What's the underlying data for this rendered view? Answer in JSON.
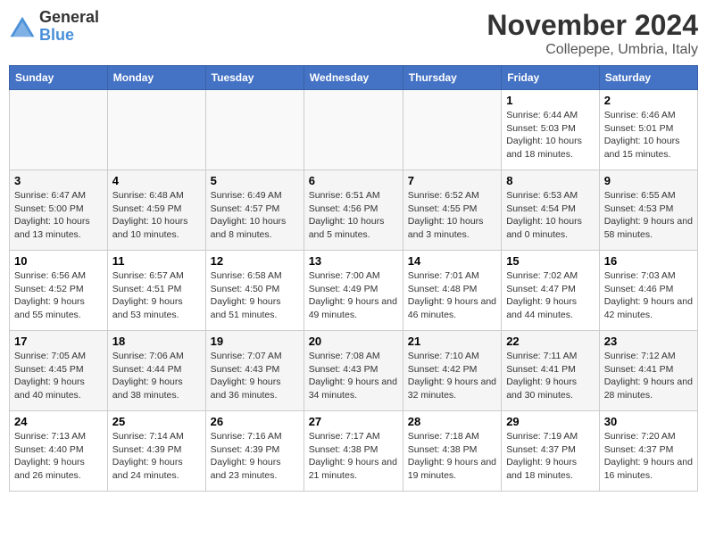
{
  "header": {
    "logo_general": "General",
    "logo_blue": "Blue",
    "month_title": "November 2024",
    "location": "Collepepe, Umbria, Italy"
  },
  "weekdays": [
    "Sunday",
    "Monday",
    "Tuesday",
    "Wednesday",
    "Thursday",
    "Friday",
    "Saturday"
  ],
  "weeks": [
    [
      {
        "day": "",
        "info": ""
      },
      {
        "day": "",
        "info": ""
      },
      {
        "day": "",
        "info": ""
      },
      {
        "day": "",
        "info": ""
      },
      {
        "day": "",
        "info": ""
      },
      {
        "day": "1",
        "info": "Sunrise: 6:44 AM\nSunset: 5:03 PM\nDaylight: 10 hours and 18 minutes."
      },
      {
        "day": "2",
        "info": "Sunrise: 6:46 AM\nSunset: 5:01 PM\nDaylight: 10 hours and 15 minutes."
      }
    ],
    [
      {
        "day": "3",
        "info": "Sunrise: 6:47 AM\nSunset: 5:00 PM\nDaylight: 10 hours and 13 minutes."
      },
      {
        "day": "4",
        "info": "Sunrise: 6:48 AM\nSunset: 4:59 PM\nDaylight: 10 hours and 10 minutes."
      },
      {
        "day": "5",
        "info": "Sunrise: 6:49 AM\nSunset: 4:57 PM\nDaylight: 10 hours and 8 minutes."
      },
      {
        "day": "6",
        "info": "Sunrise: 6:51 AM\nSunset: 4:56 PM\nDaylight: 10 hours and 5 minutes."
      },
      {
        "day": "7",
        "info": "Sunrise: 6:52 AM\nSunset: 4:55 PM\nDaylight: 10 hours and 3 minutes."
      },
      {
        "day": "8",
        "info": "Sunrise: 6:53 AM\nSunset: 4:54 PM\nDaylight: 10 hours and 0 minutes."
      },
      {
        "day": "9",
        "info": "Sunrise: 6:55 AM\nSunset: 4:53 PM\nDaylight: 9 hours and 58 minutes."
      }
    ],
    [
      {
        "day": "10",
        "info": "Sunrise: 6:56 AM\nSunset: 4:52 PM\nDaylight: 9 hours and 55 minutes."
      },
      {
        "day": "11",
        "info": "Sunrise: 6:57 AM\nSunset: 4:51 PM\nDaylight: 9 hours and 53 minutes."
      },
      {
        "day": "12",
        "info": "Sunrise: 6:58 AM\nSunset: 4:50 PM\nDaylight: 9 hours and 51 minutes."
      },
      {
        "day": "13",
        "info": "Sunrise: 7:00 AM\nSunset: 4:49 PM\nDaylight: 9 hours and 49 minutes."
      },
      {
        "day": "14",
        "info": "Sunrise: 7:01 AM\nSunset: 4:48 PM\nDaylight: 9 hours and 46 minutes."
      },
      {
        "day": "15",
        "info": "Sunrise: 7:02 AM\nSunset: 4:47 PM\nDaylight: 9 hours and 44 minutes."
      },
      {
        "day": "16",
        "info": "Sunrise: 7:03 AM\nSunset: 4:46 PM\nDaylight: 9 hours and 42 minutes."
      }
    ],
    [
      {
        "day": "17",
        "info": "Sunrise: 7:05 AM\nSunset: 4:45 PM\nDaylight: 9 hours and 40 minutes."
      },
      {
        "day": "18",
        "info": "Sunrise: 7:06 AM\nSunset: 4:44 PM\nDaylight: 9 hours and 38 minutes."
      },
      {
        "day": "19",
        "info": "Sunrise: 7:07 AM\nSunset: 4:43 PM\nDaylight: 9 hours and 36 minutes."
      },
      {
        "day": "20",
        "info": "Sunrise: 7:08 AM\nSunset: 4:43 PM\nDaylight: 9 hours and 34 minutes."
      },
      {
        "day": "21",
        "info": "Sunrise: 7:10 AM\nSunset: 4:42 PM\nDaylight: 9 hours and 32 minutes."
      },
      {
        "day": "22",
        "info": "Sunrise: 7:11 AM\nSunset: 4:41 PM\nDaylight: 9 hours and 30 minutes."
      },
      {
        "day": "23",
        "info": "Sunrise: 7:12 AM\nSunset: 4:41 PM\nDaylight: 9 hours and 28 minutes."
      }
    ],
    [
      {
        "day": "24",
        "info": "Sunrise: 7:13 AM\nSunset: 4:40 PM\nDaylight: 9 hours and 26 minutes."
      },
      {
        "day": "25",
        "info": "Sunrise: 7:14 AM\nSunset: 4:39 PM\nDaylight: 9 hours and 24 minutes."
      },
      {
        "day": "26",
        "info": "Sunrise: 7:16 AM\nSunset: 4:39 PM\nDaylight: 9 hours and 23 minutes."
      },
      {
        "day": "27",
        "info": "Sunrise: 7:17 AM\nSunset: 4:38 PM\nDaylight: 9 hours and 21 minutes."
      },
      {
        "day": "28",
        "info": "Sunrise: 7:18 AM\nSunset: 4:38 PM\nDaylight: 9 hours and 19 minutes."
      },
      {
        "day": "29",
        "info": "Sunrise: 7:19 AM\nSunset: 4:37 PM\nDaylight: 9 hours and 18 minutes."
      },
      {
        "day": "30",
        "info": "Sunrise: 7:20 AM\nSunset: 4:37 PM\nDaylight: 9 hours and 16 minutes."
      }
    ]
  ]
}
